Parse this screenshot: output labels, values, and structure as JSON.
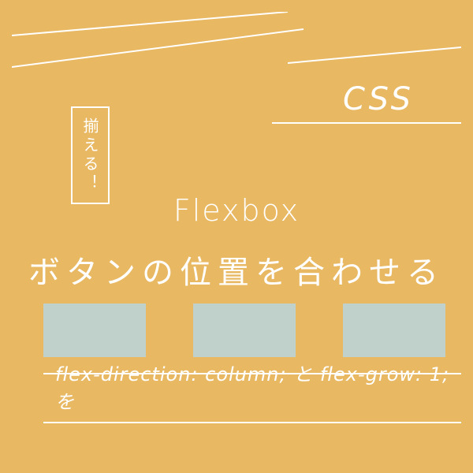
{
  "category": "CSS",
  "vertical_label": "揃える！",
  "title_line1": "Flexbox",
  "title_line2": "ボタンの位置を合わせる",
  "code_snippet": "flex-direction: column; と flex-grow: 1; を"
}
